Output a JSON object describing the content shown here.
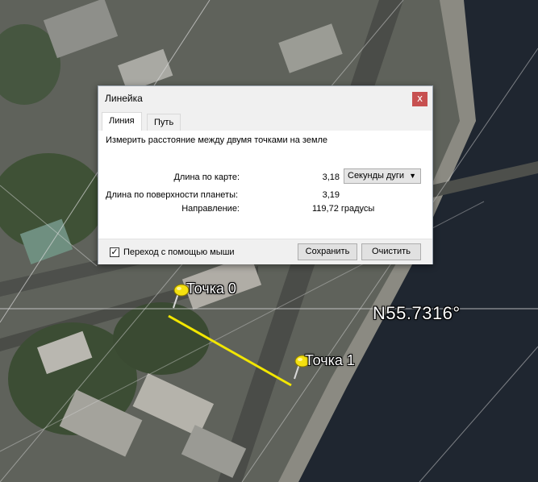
{
  "map": {
    "coordinate_label": "N55.7316°",
    "pins": [
      {
        "label": "Точка 0"
      },
      {
        "label": "Точка 1"
      }
    ],
    "colors": {
      "measure_line": "#f2e600",
      "water": "#1f2630",
      "grid": "#d8d8d8"
    }
  },
  "dialog": {
    "title": "Линейка",
    "close_glyph": "x",
    "tabs": [
      {
        "label": "Линия",
        "active": true
      },
      {
        "label": "Путь",
        "active": false
      }
    ],
    "description": "Измерить расстояние между двумя точками на земле",
    "rows": {
      "map_length": {
        "label": "Длина по карте:",
        "value": "3,18"
      },
      "surface_length": {
        "label": "Длина по поверхности планеты:",
        "value": "3,19"
      },
      "heading": {
        "label": "Направление:",
        "value": "119,72 градусы"
      }
    },
    "units": {
      "selected": "Секунды дуги"
    },
    "mouse_nav": {
      "label": "Переход с помощью мыши",
      "checked": true,
      "check_glyph": "✓"
    },
    "buttons": {
      "save": "Сохранить",
      "clear": "Очистить"
    }
  }
}
